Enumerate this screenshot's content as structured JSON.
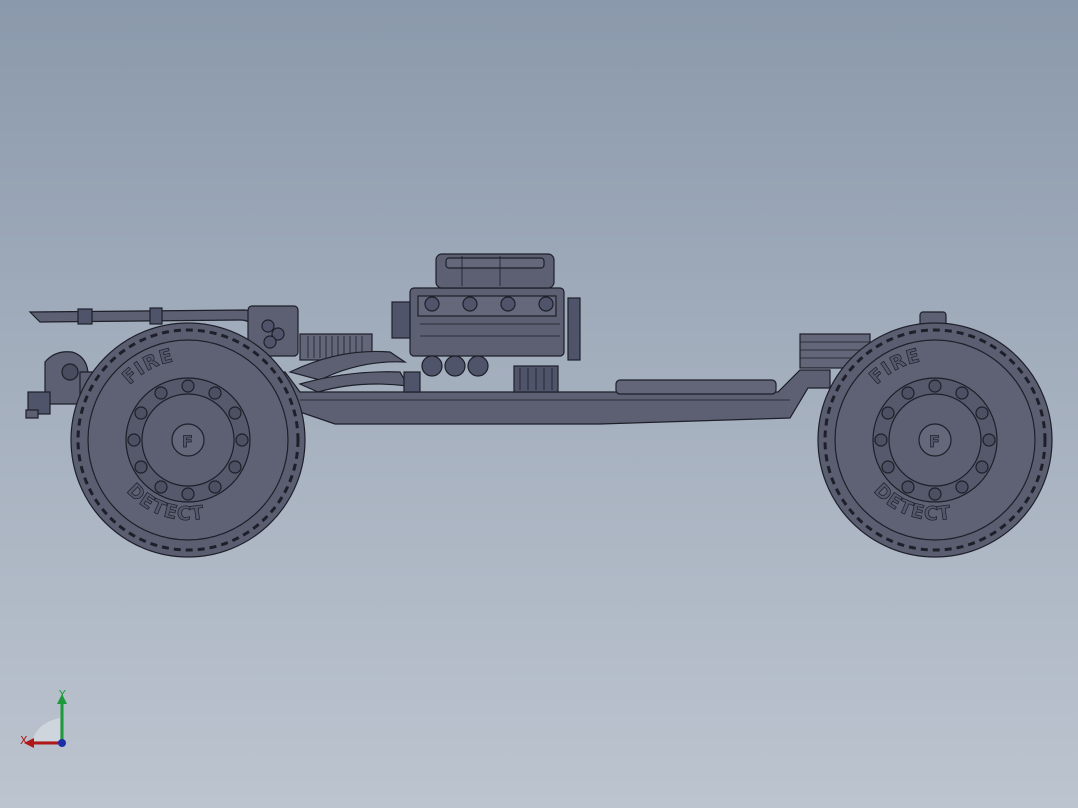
{
  "viewport": {
    "background_top": "#8a99ab",
    "background_bottom": "#bcc4cf"
  },
  "model": {
    "body_color": "#5c6072",
    "edge_color": "#1d1f29",
    "tires": [
      {
        "ring_text_top": "FIRE",
        "ring_text_bottom": "DETECT",
        "hub_logo": "F"
      },
      {
        "ring_text_top": "FIRE",
        "ring_text_bottom": "DETECT",
        "hub_logo": "F"
      }
    ]
  },
  "triad": {
    "x_label": "X",
    "y_label": "Y",
    "x_color": "#b01818",
    "y_color": "#1e9a3a",
    "z_color": "#1c2ea8"
  }
}
